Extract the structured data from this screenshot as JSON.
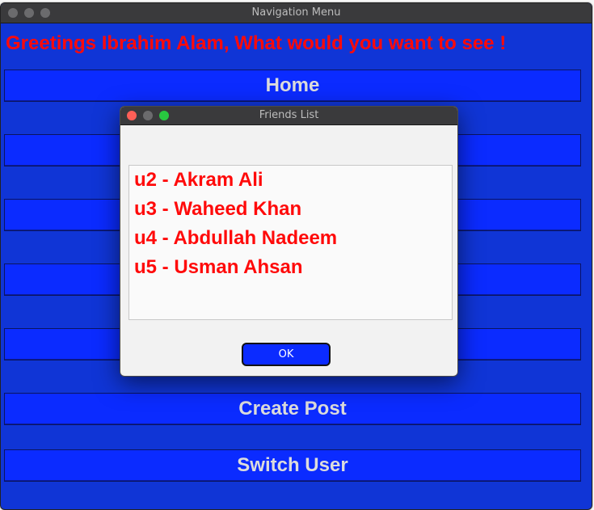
{
  "main_window": {
    "title": "Navigation Menu",
    "greeting": "Greetings Ibrahim Alam, What would you want to see !",
    "menu_buttons": [
      {
        "label": "Home"
      },
      {
        "label": ""
      },
      {
        "label": ""
      },
      {
        "label": ""
      },
      {
        "label": ""
      },
      {
        "label": "Create Post"
      },
      {
        "label": "Switch User"
      }
    ]
  },
  "dialog": {
    "title": "Friends List",
    "friends": [
      "u2 - Akram Ali",
      "u3 - Waheed Khan",
      "u4 - Abdullah Nadeem",
      "u5 - Usman Ahsan"
    ],
    "ok_label": "OK"
  },
  "colors": {
    "window_background": "#1035d6",
    "button_background": "#0b2bff",
    "accent_text": "#ff0a0a",
    "button_text": "#dcdcdc"
  }
}
